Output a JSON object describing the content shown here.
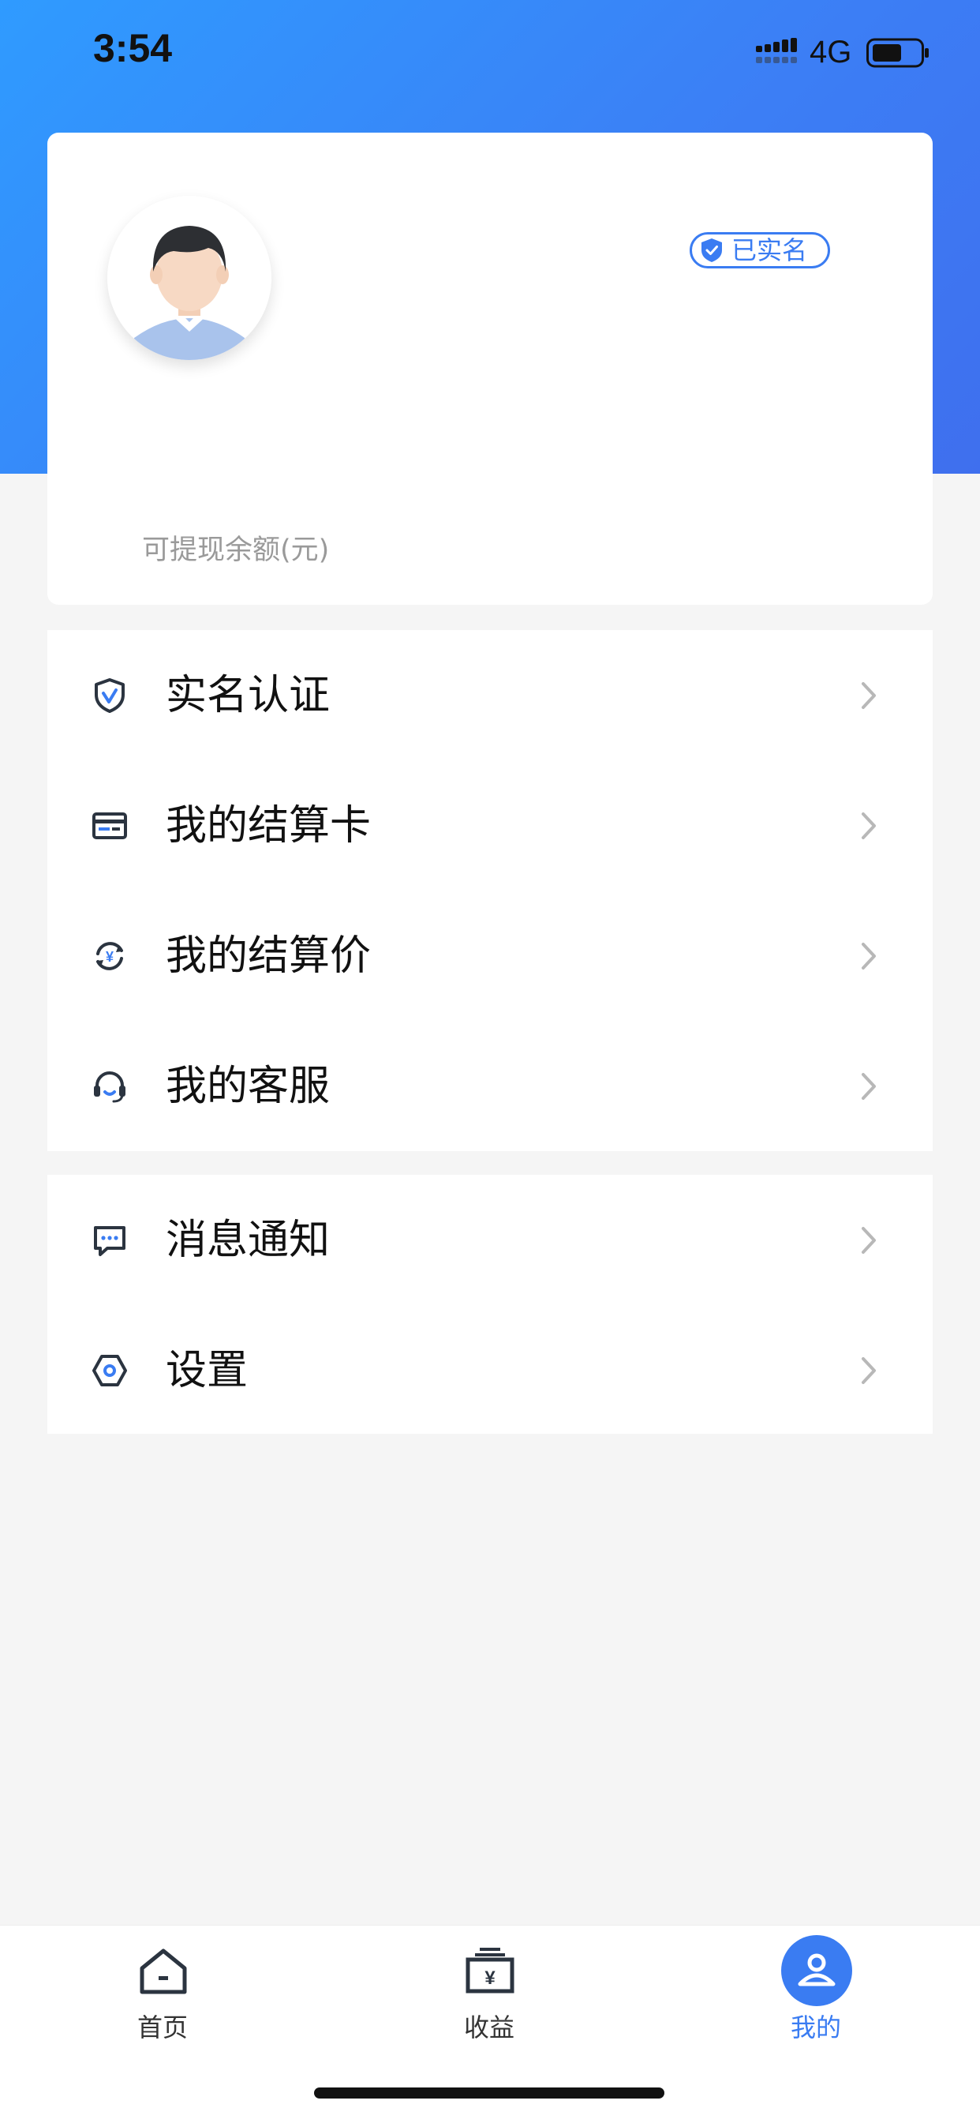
{
  "status_bar": {
    "time": "3:54",
    "network": "4G"
  },
  "profile": {
    "verified_badge": "已实名",
    "balance_label": "可提现余额(元)"
  },
  "menu_group_1": [
    {
      "label": "实名认证",
      "icon": "shield-check-icon"
    },
    {
      "label": "我的结算卡",
      "icon": "card-icon"
    },
    {
      "label": "我的结算价",
      "icon": "yuan-refresh-icon"
    },
    {
      "label": "我的客服",
      "icon": "headset-icon"
    }
  ],
  "menu_group_2": [
    {
      "label": "消息通知",
      "icon": "message-icon"
    },
    {
      "label": "设置",
      "icon": "settings-icon"
    }
  ],
  "tab_bar": {
    "home": "首页",
    "earnings": "收益",
    "mine": "我的",
    "active": "mine"
  },
  "colors": {
    "accent": "#3a7cf2",
    "header_gradient_start": "#2f9bff",
    "header_gradient_end": "#3f6fee"
  }
}
